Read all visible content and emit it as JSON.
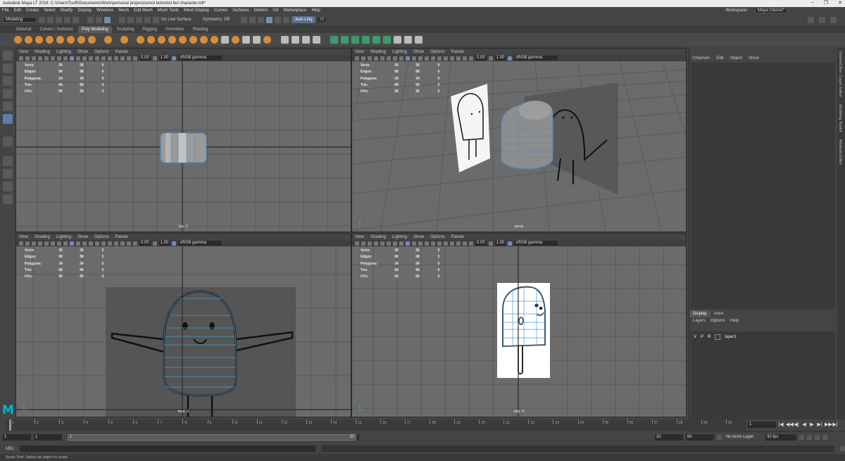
{
  "window": {
    "title": "Autodesk Maya LT 2018: C:\\Users\\Tsoffi\\Documents\\Work\\personal projects\\smol boi\\smol boi character.mlt*"
  },
  "menubar": {
    "items": [
      "File",
      "Edit",
      "Create",
      "Select",
      "Modify",
      "Display",
      "Windows",
      "Mesh",
      "Edit Mesh",
      "Mesh Tools",
      "Mesh Display",
      "Curves",
      "Surfaces",
      "Deform",
      "UV",
      "Marketplace",
      "Help"
    ],
    "workspace_label": "Workspace:",
    "workspace_value": "Maya Classic*"
  },
  "statusline": {
    "mode": "Modeling",
    "live_surface": "No Live Surface",
    "symmetry": "Symmetry: Off",
    "user": "Josh Ling",
    "notifications": "19"
  },
  "shelf": {
    "tabs": [
      "General",
      "Curves / Surfaces",
      "Poly Modeling",
      "Sculpting",
      "Rigging",
      "Animation",
      "Shading"
    ],
    "active": "Poly Modeling"
  },
  "viewport_menu": [
    "View",
    "Shading",
    "Lighting",
    "Show",
    "Options",
    "Panels"
  ],
  "viewport_fields": {
    "exposure": "0.00",
    "gamma": "1.00",
    "colorspace": "sRGB gamma"
  },
  "hud": {
    "labels": [
      "Verts:",
      "Edges:",
      "Polygons:",
      "Tris:",
      "UVs:"
    ],
    "col1": [
      "36",
      "68",
      "34",
      "68",
      "56"
    ],
    "col2": [
      "36",
      "68",
      "34",
      "68",
      "56"
    ],
    "col3": [
      "0",
      "0",
      "0",
      "0",
      "0"
    ]
  },
  "viewports": {
    "top": "top -Y",
    "persp": "persp",
    "front": "front -Z",
    "side": "side -X"
  },
  "channelbox": {
    "menu": [
      "Channels",
      "Edit",
      "Object",
      "Show"
    ]
  },
  "layers": {
    "tabs": [
      "Display",
      "Anim"
    ],
    "menu": [
      "Layers",
      "Options",
      "Help"
    ],
    "vis": "V",
    "playback": "P",
    "ref": "R",
    "layer_name": "layer1"
  },
  "sidetabs": [
    "Channel Box / Layer Editor",
    "Modeling Toolkit",
    "Attribute Editor"
  ],
  "timeline": {
    "ticks": [
      "1",
      "2",
      "3",
      "4",
      "5",
      "6",
      "7",
      "8",
      "9",
      "10",
      "11",
      "12",
      "13",
      "14",
      "15",
      "16",
      "17",
      "18",
      "19",
      "20",
      "21",
      "22",
      "23",
      "24",
      "25",
      "26",
      "27",
      "28",
      "29",
      "30"
    ],
    "current_frame": "1",
    "playback_buttons": [
      "|◀",
      "◀◀",
      "◀|",
      "◀",
      "▶",
      "▶|",
      "▶▶",
      "▶|"
    ]
  },
  "range": {
    "start": "1",
    "inner_start": "1",
    "bar_start": "1",
    "bar_end": "30",
    "inner_end": "30",
    "end": "60",
    "anim_layer": "No Anim Layer",
    "fps": "30 fps",
    "fill_fraction": 0.99
  },
  "cmdline": {
    "label": "MEL"
  },
  "helpline": {
    "text": "Scale Tool: Select an object to scale."
  }
}
